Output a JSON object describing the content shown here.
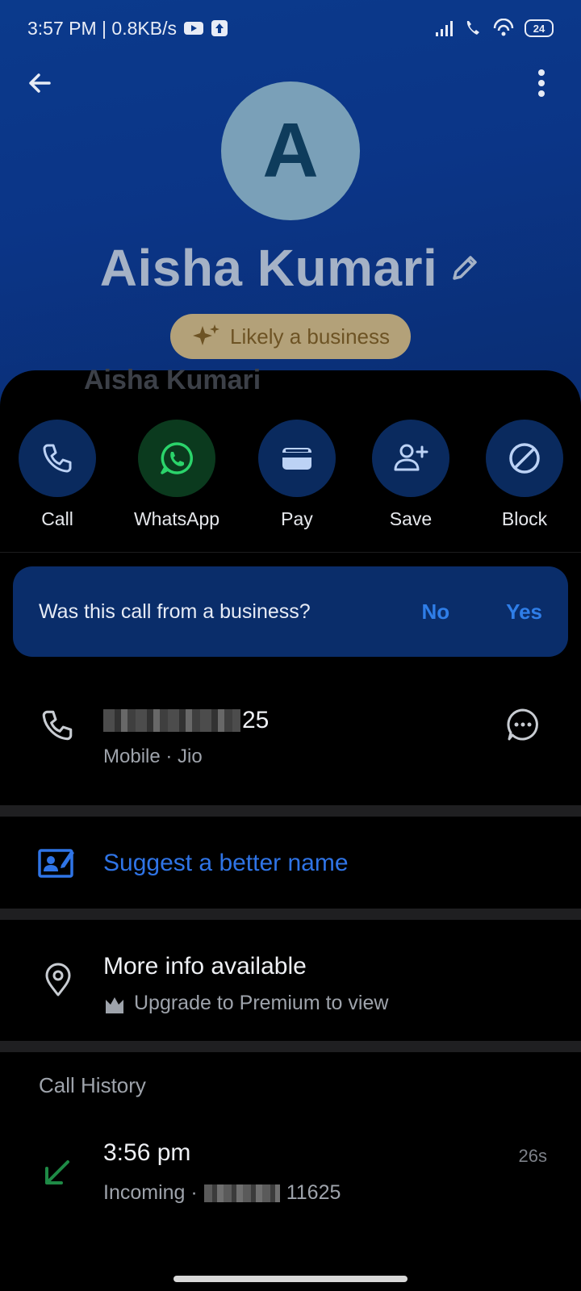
{
  "status_bar": {
    "time_speed": "3:57 PM | 0.8KB/s",
    "battery": "24"
  },
  "contact": {
    "avatar_letter": "A",
    "name": "Aisha Kumari",
    "badge": "Likely a business",
    "sheet_title": "Aisha Kumari"
  },
  "actions": [
    {
      "label": "Call",
      "icon": "phone-icon"
    },
    {
      "label": "WhatsApp",
      "icon": "whatsapp-icon"
    },
    {
      "label": "Pay",
      "icon": "wallet-icon"
    },
    {
      "label": "Save",
      "icon": "add-person-icon"
    },
    {
      "label": "Block",
      "icon": "block-icon"
    }
  ],
  "question": {
    "text": "Was this call from a business?",
    "no": "No",
    "yes": "Yes"
  },
  "number": {
    "suffix": "25",
    "sub": "Mobile · Jio"
  },
  "suggest": {
    "label": "Suggest a better name"
  },
  "info": {
    "title": "More info available",
    "sub": "Upgrade to Premium to view"
  },
  "history": {
    "header": "Call History",
    "time": "3:56 pm",
    "type": "Incoming ·",
    "number_suffix": "11625",
    "duration": "26s"
  },
  "colors": {
    "accent": "#2f74e6",
    "header_bg": "#0b3a8c",
    "badge_bg": "#b3a179",
    "incoming_arrow": "#1e8a46"
  }
}
